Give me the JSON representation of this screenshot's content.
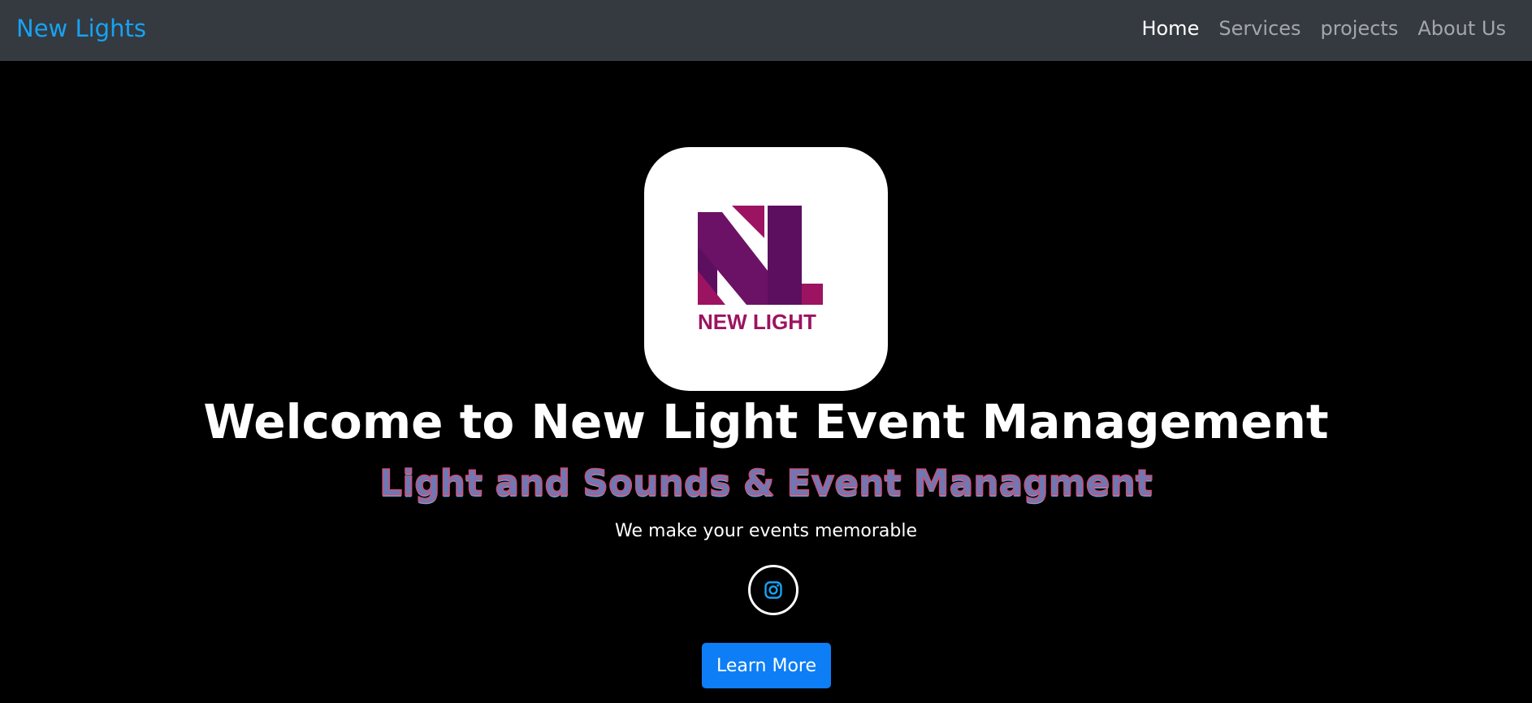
{
  "navbar": {
    "brand": "New Lights",
    "links": [
      {
        "label": "Home",
        "active": true
      },
      {
        "label": "Services",
        "active": false
      },
      {
        "label": "projects",
        "active": false
      },
      {
        "label": "About Us",
        "active": false
      }
    ]
  },
  "hero": {
    "logo": {
      "text": "NEW LIGHT",
      "colors": {
        "dark": "#5c0f5f",
        "magenta": "#9c1361"
      }
    },
    "title": "Welcome to New Light Event Management",
    "subtitle": "Light and Sounds & Event Managment",
    "tagline": "We make your events memorable",
    "social": {
      "icon": "instagram-icon",
      "color": "#17a2f3"
    },
    "cta_label": "Learn More"
  },
  "colors": {
    "navbar_bg": "#343a40",
    "brand": "#17a2f3",
    "page_bg": "#000000",
    "button": "#0d7ef5"
  }
}
